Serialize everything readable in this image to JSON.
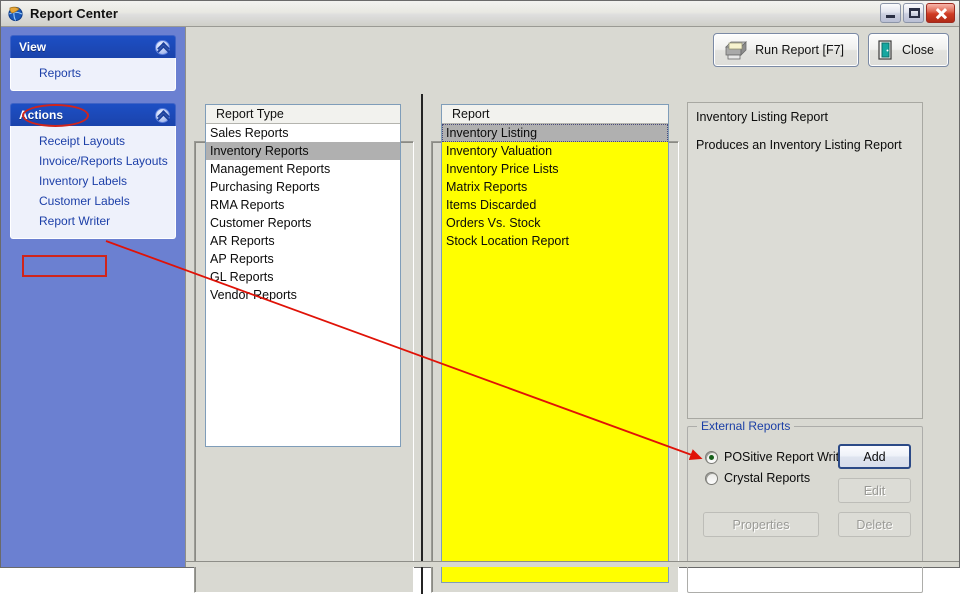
{
  "window": {
    "title": "Report Center",
    "icon": "app-globe-icon",
    "controls": {
      "minimize": "Minimize",
      "maximize": "Maximize",
      "close": "Close"
    }
  },
  "toolbar": {
    "run_report_label": "Run Report [F7]",
    "close_label": "Close"
  },
  "sidebar": {
    "groups": [
      {
        "title": "View",
        "collapse_icon": "chevron-up-icon",
        "items": [
          {
            "label": "Reports",
            "annotated": "ellipse"
          }
        ]
      },
      {
        "title": "Actions",
        "collapse_icon": "chevron-up-icon",
        "items": [
          {
            "label": "Receipt Layouts"
          },
          {
            "label": "Invoice/Reports Layouts"
          },
          {
            "label": "Inventory Labels"
          },
          {
            "label": "Customer Labels"
          },
          {
            "label": "Report Writer",
            "annotated": "rect"
          }
        ]
      }
    ]
  },
  "report_type_list": {
    "header": "Report Type",
    "selected_index": 1,
    "items": [
      "Sales Reports",
      "Inventory Reports",
      "Management Reports",
      "Purchasing Reports",
      "RMA Reports",
      "Customer Reports",
      "AR Reports",
      "AP Reports",
      "GL Reports",
      "Vendor Reports"
    ]
  },
  "report_list": {
    "header": "Report",
    "selected_index": 0,
    "background_color": "#ffff00",
    "items": [
      "Inventory Listing",
      "Inventory Valuation",
      "Inventory Price Lists",
      "Matrix Reports",
      "Items Discarded",
      "Orders Vs. Stock",
      "Stock Location Report"
    ]
  },
  "description": {
    "title": "Inventory Listing Report",
    "text": "Produces an Inventory Listing Report"
  },
  "external_reports": {
    "legend": "External Reports",
    "options": [
      {
        "label": "POSitive Report Writer",
        "selected": true
      },
      {
        "label": "Crystal Reports",
        "selected": false
      }
    ],
    "buttons": {
      "add": "Add",
      "edit": "Edit",
      "properties": "Properties",
      "delete": "Delete"
    }
  },
  "annotations": {
    "accent_color": "#d0241b",
    "arrow": "red-arrow-from-report-writer-to-positive-report-writer"
  }
}
